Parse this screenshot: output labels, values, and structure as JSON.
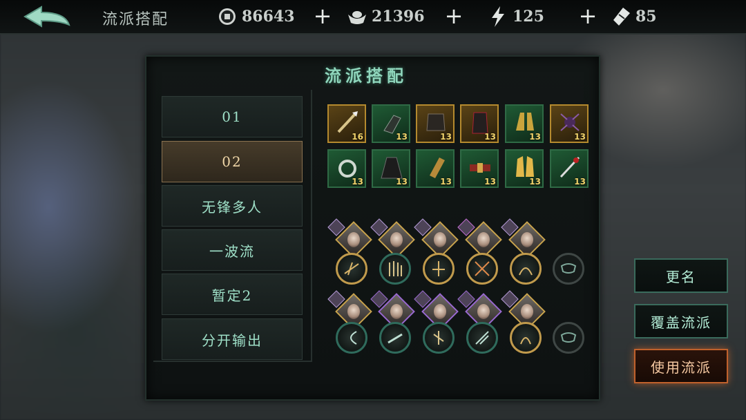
{
  "topbar": {
    "title": "流派搭配",
    "resources": [
      {
        "icon": "coin-icon",
        "value": "86643"
      },
      {
        "icon": "silver-ingot-icon",
        "value": "21396"
      },
      {
        "icon": "lightning-icon",
        "value": "125"
      },
      {
        "icon": "ticket-icon",
        "value": "85"
      }
    ],
    "plus_symbol": "+"
  },
  "panel": {
    "title": "流派搭配",
    "presets": [
      {
        "label": "01",
        "active": false
      },
      {
        "label": "02",
        "active": true
      },
      {
        "label": "无锋多人",
        "active": false
      },
      {
        "label": "一波流",
        "active": false
      },
      {
        "label": "暂定2",
        "active": false
      },
      {
        "label": "分开输出",
        "active": false
      }
    ]
  },
  "equipment": {
    "row1": [
      {
        "icon": "spear-icon",
        "level": "16",
        "rarity": "gold"
      },
      {
        "icon": "gauntlet-icon",
        "level": "13",
        "rarity": "green"
      },
      {
        "icon": "armor-icon",
        "level": "13",
        "rarity": "gold"
      },
      {
        "icon": "robe-icon",
        "level": "13",
        "rarity": "gold"
      },
      {
        "icon": "boots-icon",
        "level": "13",
        "rarity": "green"
      },
      {
        "icon": "spider-claw-icon",
        "level": "13",
        "rarity": "gold"
      }
    ],
    "row2": [
      {
        "icon": "jade-pendant-icon",
        "level": "13",
        "rarity": "green"
      },
      {
        "icon": "cloak-icon",
        "level": "13",
        "rarity": "green"
      },
      {
        "icon": "bracer-icon",
        "level": "13",
        "rarity": "green"
      },
      {
        "icon": "belt-icon",
        "level": "13",
        "rarity": "green"
      },
      {
        "icon": "golden-boots-icon",
        "level": "13",
        "rarity": "green"
      },
      {
        "icon": "blade-icon",
        "level": "13",
        "rarity": "green"
      }
    ]
  },
  "actions": {
    "rename": "更名",
    "overwrite": "覆盖流派",
    "use": "使用流派"
  },
  "colors": {
    "accent_green": "#8fd6bc",
    "gold": "#c09a4c",
    "use_button": "#c0612c"
  }
}
